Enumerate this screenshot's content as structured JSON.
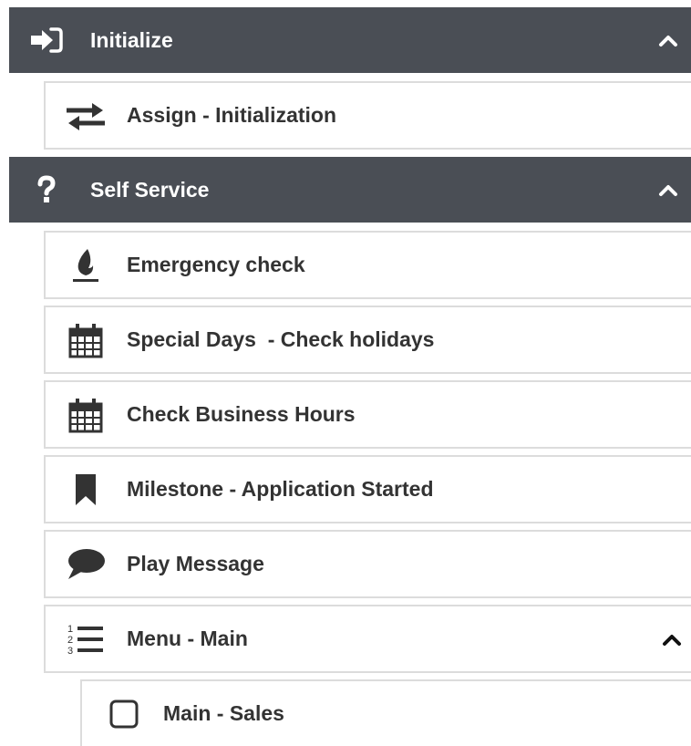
{
  "colors": {
    "header_bg": "#4a4e55",
    "header_text": "#ffffff",
    "item_border": "#dcdcdc",
    "item_text": "#333333",
    "icon": "#333333"
  },
  "sections": [
    {
      "title": "Initialize",
      "icon": "sign-in-icon",
      "expanded": true,
      "items": [
        {
          "label": "Assign - Initialization",
          "icon": "exchange-arrows-icon"
        }
      ]
    },
    {
      "title": "Self Service",
      "icon": "question-icon",
      "expanded": true,
      "items": [
        {
          "label": "Emergency check",
          "icon": "fire-icon"
        },
        {
          "label": "Special Days  - Check holidays",
          "icon": "calendar-icon"
        },
        {
          "label": "Check Business Hours",
          "icon": "calendar-icon"
        },
        {
          "label": "Milestone - Application Started",
          "icon": "bookmark-icon"
        },
        {
          "label": "Play Message",
          "icon": "speech-bubble-icon"
        },
        {
          "label": "Menu - Main",
          "icon": "numbered-list-icon",
          "expanded": true,
          "children": [
            {
              "label": "Main - Sales",
              "icon": "checkbox-icon"
            }
          ]
        }
      ]
    }
  ]
}
